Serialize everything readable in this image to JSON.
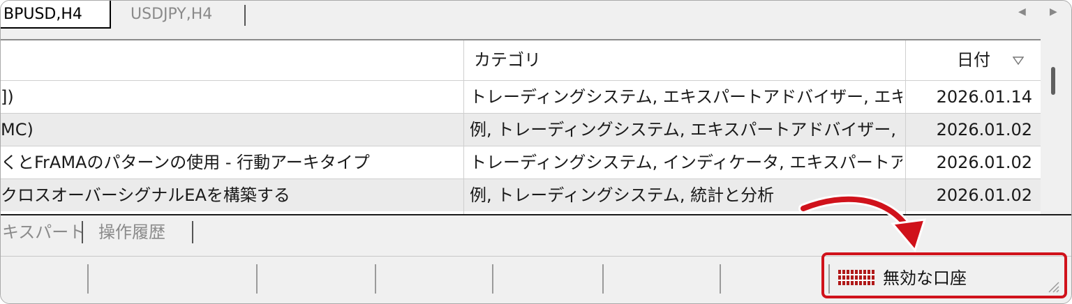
{
  "tabs": {
    "active": "BPUSD,H4",
    "inactive": "USDJPY,H4"
  },
  "table": {
    "headers": {
      "category": "カテゴリ",
      "date": "日付"
    },
    "rows": [
      {
        "name": "])",
        "category": "トレーディングシステム, エキスパートアドバイザー, エキス・..",
        "date": "2026.01.14"
      },
      {
        "name": "MC)",
        "category": "例, トレーディングシステム, エキスパートアドバイザー, エキ...",
        "date": "2026.01.02"
      },
      {
        "name": "くとFrAMAのパターンの使用 - 行動アーキタイプ",
        "category": "トレーディングシステム, インディケータ, エキスパートアドバ・..",
        "date": "2026.01.02"
      },
      {
        "name": "クロスオーバーシグナルEAを構築する",
        "category": "例, トレーディングシステム, 統計と分析",
        "date": "2026.01.02"
      }
    ]
  },
  "bottom_tabs": [
    "キスパート",
    "操作履歴"
  ],
  "status": {
    "connection_text": "無効な口座"
  },
  "colors": {
    "highlight": "#d0121b",
    "signal": "#b01818"
  },
  "icons": {
    "sort": "sort-down-icon",
    "nav_left": "arrow-left-icon",
    "nav_right": "arrow-right-icon",
    "signal": "signal-bars-icon",
    "grip": "resize-grip-icon"
  }
}
